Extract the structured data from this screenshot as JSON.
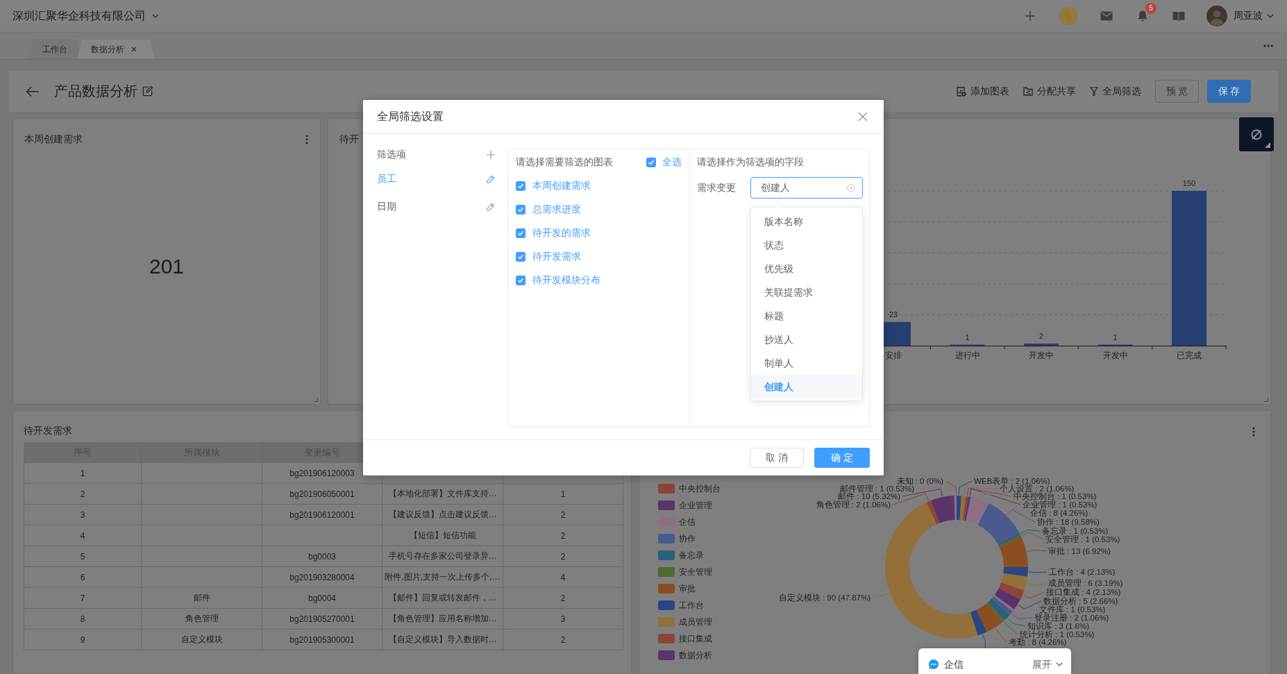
{
  "top_bar": {
    "company": "深圳汇聚华企科技有限公司",
    "notification_count": "5",
    "user": "周亚波"
  },
  "tabs": [
    {
      "label": "工作台",
      "selected": false,
      "closable": false
    },
    {
      "label": "数据分析",
      "selected": true,
      "closable": true
    }
  ],
  "header": {
    "title": "产品数据分析",
    "actions": [
      {
        "label": "添加图表",
        "kind": "add-chart"
      },
      {
        "label": "分配共享",
        "kind": "share"
      },
      {
        "label": "全局筛选",
        "kind": "filter"
      }
    ],
    "buttons": [
      {
        "label": "预 览",
        "kind": "preview"
      },
      {
        "label": "保 存",
        "kind": "save"
      }
    ]
  },
  "cards": [
    {
      "kind": "number",
      "title": "本周创建需求",
      "value": "201",
      "menu": true
    },
    {
      "kind": "bar",
      "title": "待开",
      "chart_data": {
        "type": "bar",
        "categories": [
          "安排",
          "进行中",
          "开发中",
          "开发中",
          "已完成"
        ],
        "series": [
          {
            "color": "#273e70",
            "values": [
              23,
              1,
              2,
              1,
              150
            ]
          }
        ],
        "data_labels": true
      }
    }
  ],
  "table_card": {
    "title": "待开发需求",
    "columns": [
      "序号",
      "所属模块",
      "变更编号"
    ],
    "rows": [
      {
        "no": "1",
        "change_no": "bg201906120003"
      },
      {
        "no": "2",
        "change_no": "bg201906050001",
        "column_4": "【本地化部署】文件库支持…",
        "column_5": "1"
      },
      {
        "no": "3",
        "change_no": "bg201906120001",
        "column_4": "【建议反馈】点击建议反馈…",
        "column_5": "2"
      },
      {
        "no": "4",
        "column_4": "【短信】短信功能",
        "column_5": "2"
      },
      {
        "no": "5",
        "change_no": "bg0003",
        "column_4": "手机号存在多家公司登录异…",
        "column_5": "2"
      },
      {
        "no": "6",
        "change_no": "bg201903280004",
        "column_4": "附件,图片,支持一次上传多个,…",
        "column_5": "4"
      },
      {
        "no": "7",
        "module": "邮件",
        "change_no": "bg0004",
        "column_4": "【邮件】回复或转发邮件，…",
        "column_5": "2"
      },
      {
        "no": "8",
        "module": "角色管理",
        "change_no": "bg201905270001",
        "column_4": "【角色管理】应用名称增加…",
        "column_5": "3"
      },
      {
        "no": "9",
        "module": "自定义模块",
        "change_no": "bg201905300001",
        "column_4": "【自定义模块】导入数据时…",
        "column_5": "2"
      }
    ]
  },
  "pie_card": {
    "menu": true,
    "legend": [
      {
        "label": "中央控制台",
        "color": "#8c4438"
      },
      {
        "label": "企业管理",
        "color": "#5b336c"
      },
      {
        "label": "企信",
        "color": "#8f6f86"
      },
      {
        "label": "协作",
        "color": "#4a5a8e"
      },
      {
        "label": "备忘录",
        "color": "#2a607c"
      },
      {
        "label": "安全管理",
        "color": "#4f6a32"
      },
      {
        "label": "审批",
        "color": "#8a4e22"
      },
      {
        "label": "工作台",
        "color": "#2a4583"
      },
      {
        "label": "成员管理",
        "color": "#93703a"
      },
      {
        "label": "接口集成",
        "color": "#8c4438"
      },
      {
        "label": "数据分析",
        "color": "#5b336c"
      }
    ],
    "chart_data": {
      "type": "donut",
      "categories": [
        "未知",
        "WEB表单",
        "个人设置",
        "中央控制台",
        "企业管理",
        "企信",
        "协作",
        "备忘录",
        "安全管理",
        "审批",
        "工作台",
        "成员管理",
        "接口集成",
        "数据分析",
        "文件库",
        "登录注册",
        "知识库",
        "统计分析",
        "考勤",
        null,
        "自定义模块",
        "角色管理",
        "邮件",
        "邮件管理"
      ],
      "values": [
        0,
        2,
        2,
        1,
        1,
        8,
        18,
        1,
        1,
        13,
        4,
        6,
        4,
        5,
        1,
        2,
        3,
        1,
        8,
        4,
        90,
        2,
        10,
        1
      ],
      "colors": [
        "#8a4e22",
        "#2a4583",
        "#93703a",
        "#8c4438",
        "#5b336c",
        "#8f6f86",
        "#4a5a8e",
        "#2a607c",
        "#4f6a32",
        "#8a4e22",
        "#2a4583",
        "#93703a",
        "#8c4438",
        "#5b336c",
        "#8f6f86",
        "#4a5a8e",
        "#2a607c",
        "#4f6a32",
        "#8a4e22",
        "#2a4583",
        "#93703a",
        "#8c4438",
        "#5b336c",
        "#8f6f86"
      ],
      "value_labels": [
        ": 0 (0%)",
        ": 2 (1.06%)",
        ": 2 (1.06%)",
        ": 1 (0.53%)",
        ": 1 (0.53%)",
        ": 8 (4.26%)",
        ": 18 (9.58%)",
        ": 1 (0.53%)",
        ": 1 (0.53%)",
        ": 13 (6.92%)",
        ": 4 (2.13%)",
        ": 6 (3.19%)",
        ": 4 (2.13%)",
        ": 5 (2.66%)",
        ": 1 (0.53%)",
        ": 2 (1.06%)",
        ": 3 (1.6%)",
        ": 1 (0.53%)",
        ": 8 (4.26%)",
        null,
        ": 90 (47.87%)",
        ": 2 (1.06%)",
        ": 10 (5.32%)",
        ": 1 (0.53%)"
      ]
    }
  },
  "modal": {
    "title": "全局筛选设置",
    "filter_heading": "筛选项",
    "filters": [
      {
        "label": "员工",
        "selected": true
      },
      {
        "label": "日期",
        "selected": false
      }
    ],
    "chart_heading": "请选择需要筛选的图表",
    "select_all": {
      "label": "全选",
      "checked": true
    },
    "charts": [
      {
        "label": "本周创建需求",
        "checked": true
      },
      {
        "label": "总需求进度",
        "checked": true
      },
      {
        "label": "待开发的需求",
        "checked": true
      },
      {
        "label": "待开发需求",
        "checked": true
      },
      {
        "label": "待开发模块分布",
        "checked": true
      }
    ],
    "field_heading": "请选择作为筛选项的字段",
    "field": {
      "label": "需求变更",
      "value": "创建人"
    },
    "options": [
      {
        "label": "版本名称",
        "selected": false
      },
      {
        "label": "状态",
        "selected": false
      },
      {
        "label": "优先级",
        "selected": false
      },
      {
        "label": "关联提需求",
        "selected": false
      },
      {
        "label": "标题",
        "selected": false
      },
      {
        "label": "抄送人",
        "selected": false
      },
      {
        "label": "制单人",
        "selected": false
      },
      {
        "label": "创建人",
        "selected": true
      }
    ],
    "buttons": [
      {
        "label": "取 消",
        "kind": "cancel"
      },
      {
        "label": "确 定",
        "kind": "confirm"
      }
    ]
  },
  "chat_widget": {
    "title": "企信",
    "action": "展开"
  }
}
